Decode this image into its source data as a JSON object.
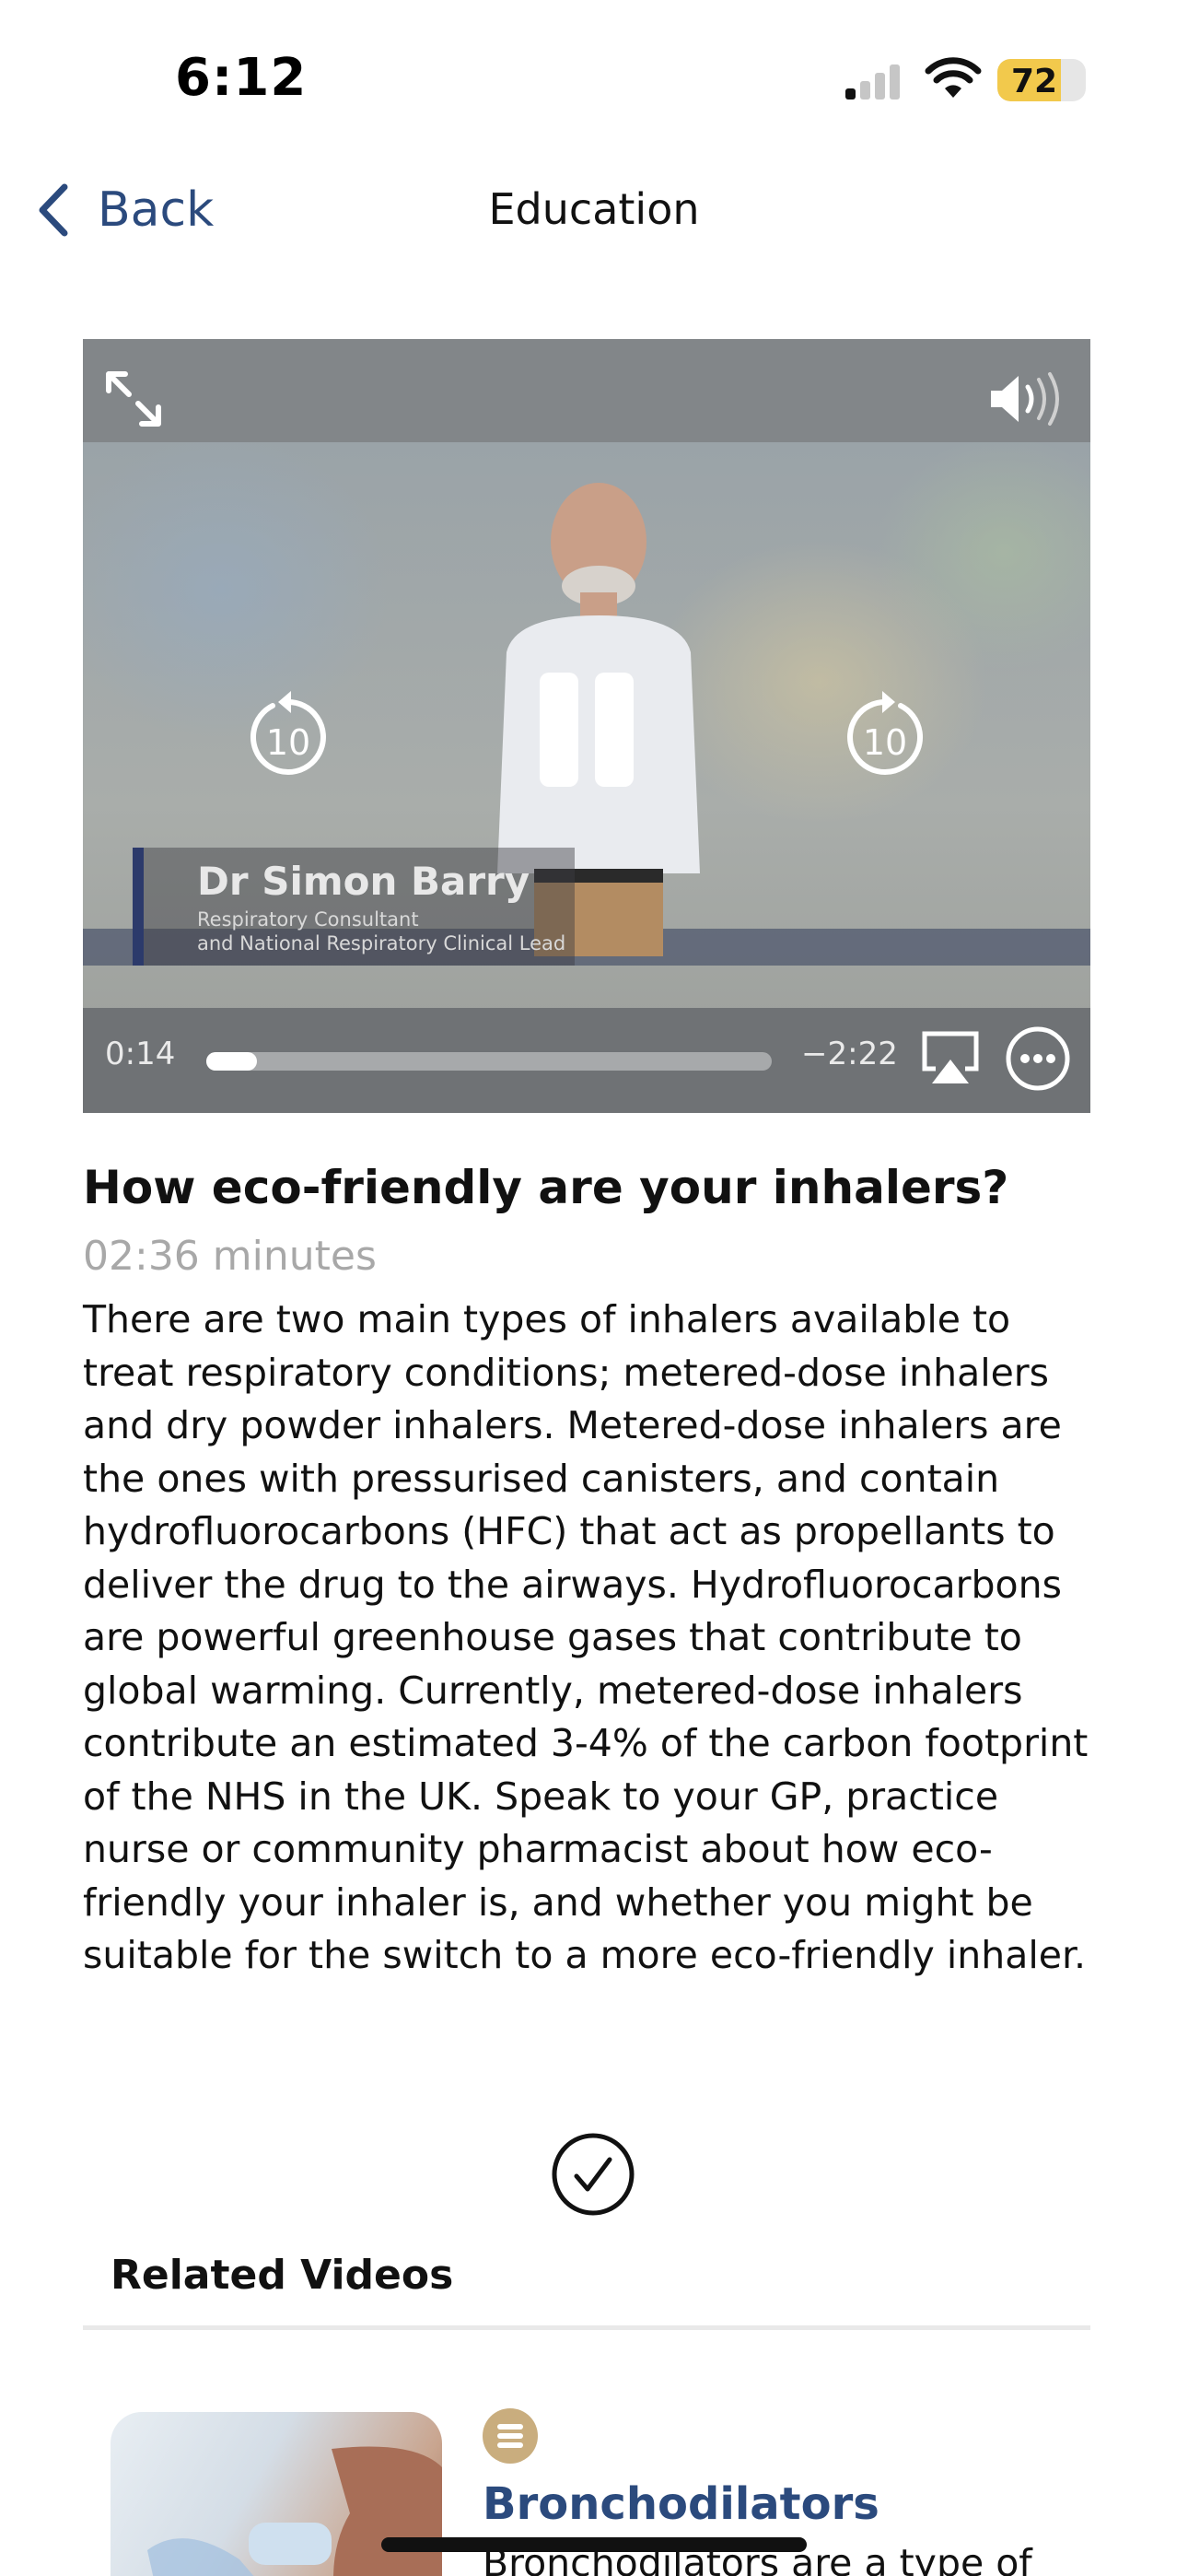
{
  "status_bar": {
    "time": "6:12",
    "battery_level": "72",
    "battery_fraction": 0.72,
    "signal_bars_active": 1,
    "signal_bars_total": 4
  },
  "nav": {
    "back_label": "Back",
    "title": "Education"
  },
  "video": {
    "presenter_name": "Dr Simon Barry",
    "presenter_role_line1": "Respiratory Consultant",
    "presenter_role_line2": "and National Respiratory Clinical Lead",
    "skip_back_seconds": "10",
    "skip_forward_seconds": "10",
    "time_elapsed": "0:14",
    "time_remaining": "−2:22",
    "progress_fraction": 0.09
  },
  "article": {
    "title": "How eco-friendly are your inhalers?",
    "duration": "02:36 minutes",
    "body": "There are two main types of inhalers available to treat respiratory conditions; metered-dose inhalers and dry powder inhalers. Metered-dose inhalers are the ones with pressurised canisters, and contain hydrofluorocarbons (HFC) that act as propellants to deliver the drug to the airways. Hydrofluorocarbons are powerful greenhouse gases that contribute to global warming. Currently, metered-dose inhalers contribute an estimated 3-4% of the carbon footprint of the NHS in the UK. Speak to your GP, practice nurse or community pharmacist about how eco-friendly your inhaler is, and whether you might be suitable for the switch to a more eco-friendly inhaler."
  },
  "related": {
    "heading": "Related Videos",
    "items": [
      {
        "title": "Bronchodilators",
        "description": "Bronchodilators are a type of"
      }
    ]
  },
  "colors": {
    "accent": "#2b4a7d",
    "battery": "#f2c94c",
    "badge": "#c9ad7e"
  }
}
